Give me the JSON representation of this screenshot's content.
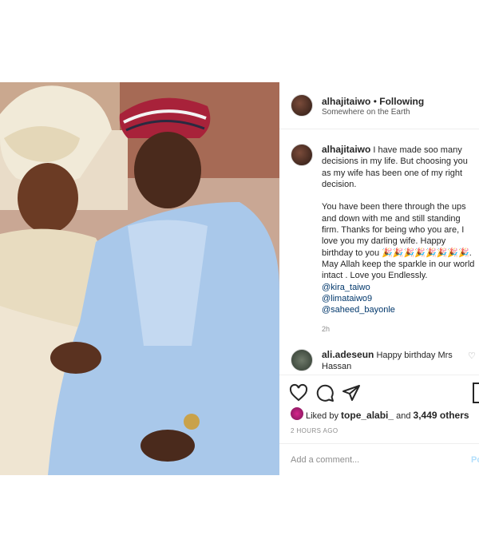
{
  "post": {
    "username": "alhajitaiwo",
    "separator": " • ",
    "follow_status": "Following",
    "location": "Somewhere on the Earth",
    "caption_text": "I have made soo many decisions in my life. But choosing you as my wife has been one of my right decision.\n\nYou have been there through the ups and down with me and still standing firm. Thanks for being who you are, I love you my darling wife. Happy birthday to you 🎉🎉🎉🎉🎉🎉🎉🎉. May Allah keep the sparkle in our world intact . Love you Endlessly.",
    "mentions": [
      "@kira_taiwo",
      "@limataiwo9",
      "@saheed_bayonle"
    ],
    "time": "2h",
    "comment": {
      "username": "ali.adeseun",
      "text": "Happy birthday Mrs Hassan"
    },
    "likes": {
      "prefix": "Liked by ",
      "user": "tope_alabi_",
      "middle": " and ",
      "count": "3,449 others"
    },
    "time_ago": "2 HOURS AGO",
    "add_comment_placeholder": "Add a comment...",
    "post_button": "Post"
  },
  "icons": {
    "like": "heart-icon",
    "comment": "comment-icon",
    "share": "share-icon",
    "save": "bookmark-icon"
  },
  "colors": {
    "link": "#00376b",
    "muted": "#8e8e8e",
    "border": "#efefef"
  }
}
